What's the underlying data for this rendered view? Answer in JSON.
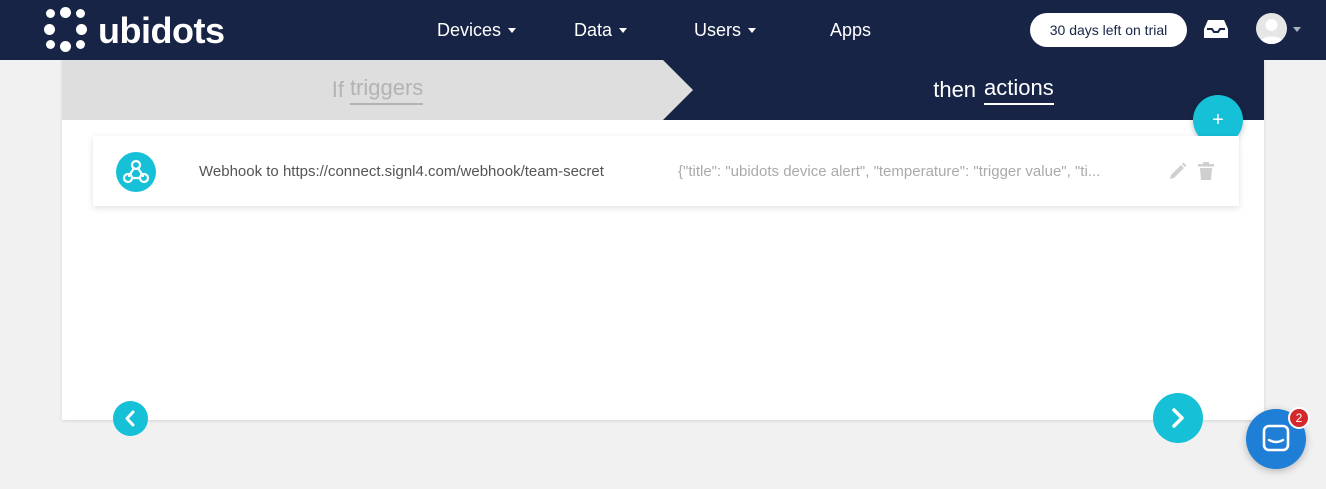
{
  "app": {
    "logo_text": "ubidots"
  },
  "nav": {
    "devices": "Devices",
    "data": "Data",
    "users": "Users",
    "apps": "Apps"
  },
  "trial": {
    "label": "30 days left on trial"
  },
  "steps": {
    "if_prefix": "If",
    "if_word": "triggers",
    "then_prefix": "then",
    "then_word": "actions"
  },
  "add_button": {
    "label": "+"
  },
  "actions": [
    {
      "icon": "webhook-icon",
      "label": "Webhook to https://connect.signl4.com/webhook/team-secret",
      "payload": "{\"title\": \"ubidots device alert\", \"temperature\": \"trigger value\", \"ti..."
    }
  ],
  "chat": {
    "badge_count": "2"
  },
  "colors": {
    "navy": "#172445",
    "accent": "#16c0d6",
    "chat_blue": "#1f7fd6",
    "badge_red": "#d3282c"
  }
}
